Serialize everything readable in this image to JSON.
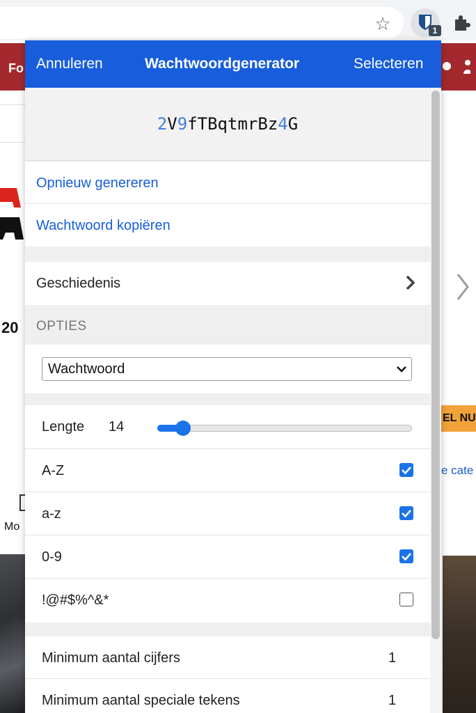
{
  "browser": {
    "extension_badge": "1"
  },
  "background_page": {
    "header_fragment": "Fo",
    "fragment_20": "20",
    "el_nu": "EL NU",
    "e_cate": "e cate",
    "mo": "Mo"
  },
  "popup": {
    "header": {
      "cancel": "Annuleren",
      "title": "Wachtwoordgenerator",
      "select": "Selecteren"
    },
    "password": {
      "value": "2V9fTBqtmrBz4G"
    },
    "actions": {
      "regenerate": "Opnieuw genereren",
      "copy": "Wachtwoord kopiëren"
    },
    "history": {
      "label": "Geschiedenis"
    },
    "options": {
      "heading": "OPTIES",
      "type_select": "Wachtwoord",
      "length_label": "Lengte",
      "length_value": "14",
      "length_slider_fraction": 0.1,
      "uppercase": {
        "label": "A-Z",
        "checked": true
      },
      "lowercase": {
        "label": "a-z",
        "checked": true
      },
      "numbers": {
        "label": "0-9",
        "checked": true
      },
      "special": {
        "label": "!@#$%^&*",
        "checked": false
      },
      "min_numbers": {
        "label": "Minimum aantal cijfers",
        "value": "1"
      },
      "min_special": {
        "label": "Minimum aantal speciale tekens",
        "value": "1"
      }
    }
  },
  "colors": {
    "header_blue": "#175ddc",
    "accent": "#1a73e8",
    "site_red": "#a3292e"
  }
}
